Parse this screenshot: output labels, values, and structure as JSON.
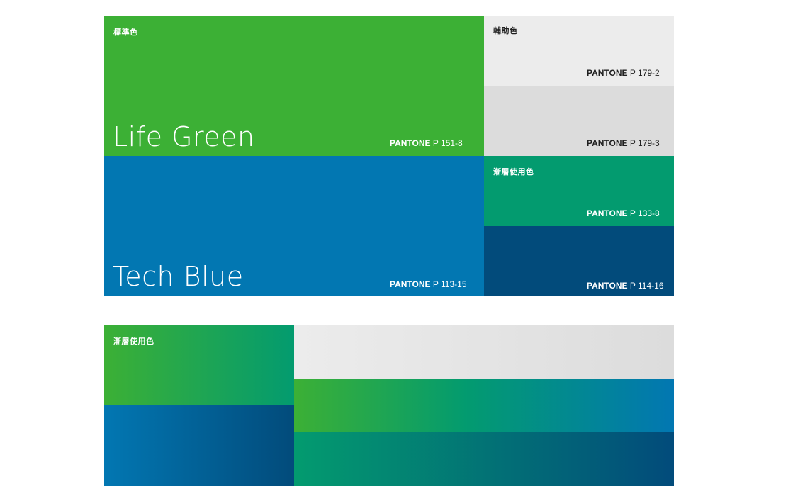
{
  "labels": {
    "standard": "標準色",
    "auxiliary": "輔助色",
    "gradient": "漸層使用色",
    "gradient_bottom": "漸層使用色"
  },
  "primary": {
    "green_name": "Life Green",
    "blue_name": "Tech Blue",
    "green_brand": "PANTONE",
    "green_code": "P 151-8",
    "blue_brand": "PANTONE",
    "blue_code": "P 113-15"
  },
  "auxiliary": {
    "grey1_brand": "PANTONE",
    "grey1_code": "P 179-2",
    "grey2_brand": "PANTONE",
    "grey2_code": "P 179-3"
  },
  "gradient_colors": {
    "teal_brand": "PANTONE",
    "teal_code": "P 133-8",
    "navy_brand": "PANTONE",
    "navy_code": "P 114-16"
  },
  "colors": {
    "life_green": "#3cb035",
    "tech_blue": "#0277b2",
    "grey_light": "#ececec",
    "grey_mid": "#dcdcdc",
    "teal": "#039b6f",
    "navy": "#024b7b"
  }
}
